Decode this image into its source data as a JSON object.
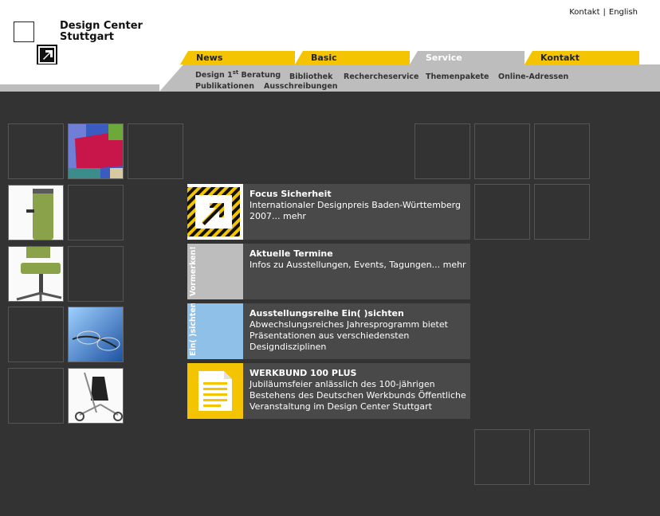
{
  "header": {
    "links": {
      "kontakt": "Kontakt",
      "separator": "|",
      "english": "English"
    },
    "logo": {
      "line1": "Design Center",
      "line2": "Stuttgart"
    }
  },
  "tabs": [
    {
      "label": "News",
      "color": "#f5c400"
    },
    {
      "label": "Basic",
      "color": "#f5c400"
    },
    {
      "label": "Service",
      "color": "#bdbdbd",
      "active": true
    },
    {
      "label": "Kontakt",
      "color": "#f5c400"
    }
  ],
  "subnav": {
    "design_prefix": "Design 1",
    "design_sup": "st",
    "design_suffix": " Beratung",
    "bibliothek": "Bibliothek",
    "rechercheservice": "Rechercheservice",
    "themenpakete": "Themenpakete",
    "online_adressen": "Online-Adressen",
    "publikationen": "Publikationen",
    "ausschreibungen": "Ausschreibungen"
  },
  "news": [
    {
      "title": "Focus Sicherheit",
      "text": "Internationaler Designpreis Baden-Württemberg 2007... mehr",
      "icon": "yellow-black-arrow-logo"
    },
    {
      "title": "Aktuelle Termine",
      "text": "Infos zu Ausstellungen, Events, Tagungen... mehr",
      "thumb_label": "Vormerken!"
    },
    {
      "title": "Ausstellungsreihe Ein( )sichten",
      "text": "Abwechslungsreiches Jahresprogramm bietet Präsentationen aus verschiedensten Designdisziplinen",
      "thumb_label": "Ein( )sichten"
    },
    {
      "title": "WERKBUND 100 PLUS",
      "text": "Jubiläumsfeier anlässlich des 100-jährigen Bestehens des Deutschen Werkbunds Öffentliche Veranstaltung im Design Center Stuttgart",
      "icon": "document-icon"
    }
  ],
  "colors": {
    "accent": "#f5c400",
    "grey": "#bdbdbd",
    "background": "#333333",
    "news_bg": "#4a4949"
  }
}
